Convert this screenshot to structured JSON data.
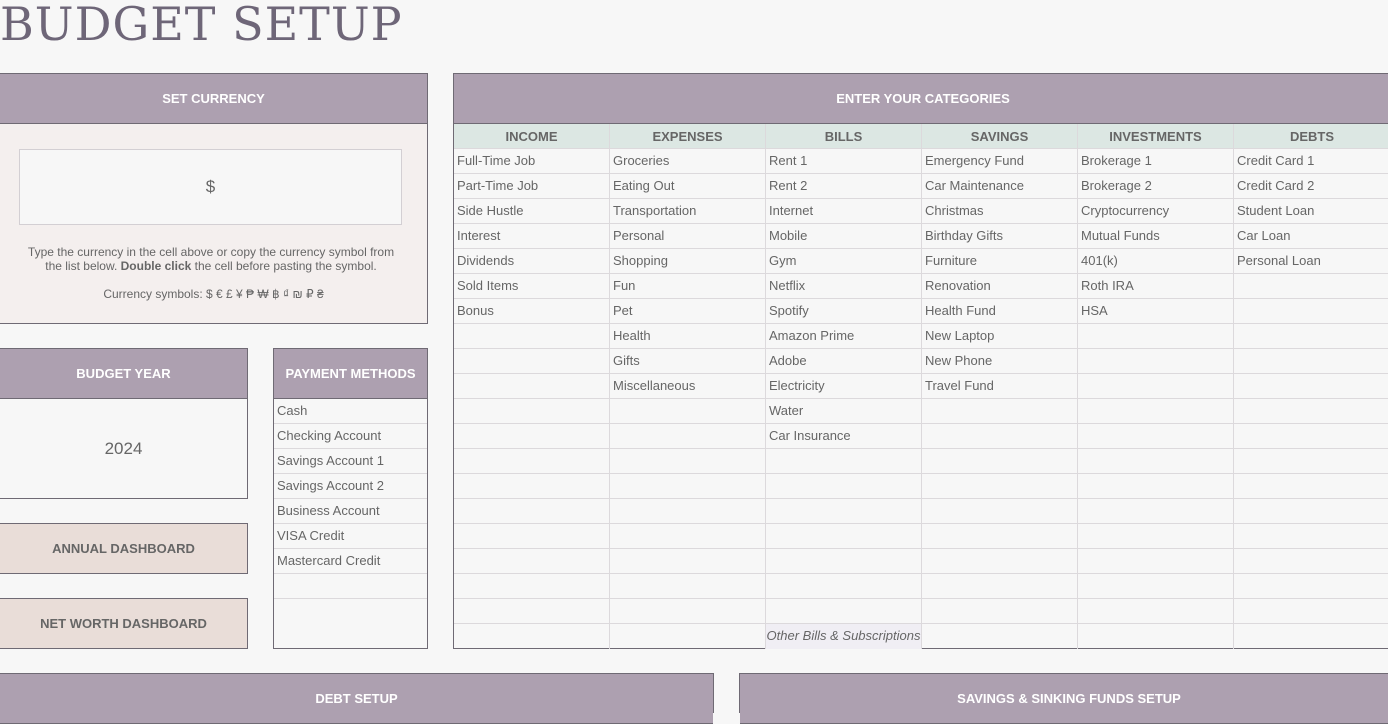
{
  "page_title": "BUDGET SETUP",
  "currency": {
    "header": "SET CURRENCY",
    "value": "$",
    "help_before": "Type the currency in the cell above or copy the currency symbol from the list below. ",
    "help_bold": "Double click",
    "help_after": " the cell before pasting the symbol.",
    "symbols_label": "Currency symbols: $ € £ ¥ ₱ ₩ ฿ ₫ ₪ ₽ ₴"
  },
  "budget_year": {
    "header": "BUDGET YEAR",
    "value": "2024"
  },
  "buttons": {
    "annual": "ANNUAL DASHBOARD",
    "net_worth": "NET WORTH DASHBOARD"
  },
  "payment_methods": {
    "header": "PAYMENT METHODS",
    "items": [
      "Cash",
      "Checking Account",
      "Savings Account 1",
      "Savings Account 2",
      "Business Account",
      "VISA Credit",
      "Mastercard Credit",
      "",
      ""
    ]
  },
  "categories": {
    "header": "ENTER YOUR CATEGORIES",
    "columns": [
      {
        "title": "INCOME",
        "items": [
          "Full-Time Job",
          "Part-Time Job",
          "Side Hustle",
          "Interest",
          "Dividends",
          "Sold Items",
          "Bonus",
          "",
          "",
          "",
          "",
          "",
          "",
          "",
          "",
          "",
          "",
          "",
          "",
          ""
        ]
      },
      {
        "title": "EXPENSES",
        "items": [
          "Groceries",
          "Eating Out",
          "Transportation",
          "Personal",
          "Shopping",
          "Fun",
          "Pet",
          "Health",
          "Gifts",
          "Miscellaneous",
          "",
          "",
          "",
          "",
          "",
          "",
          "",
          "",
          "",
          ""
        ]
      },
      {
        "title": "BILLS",
        "items": [
          "Rent 1",
          "Rent 2",
          "Internet",
          "Mobile",
          "Gym",
          "Netflix",
          "Spotify",
          "Amazon Prime",
          "Adobe",
          "Electricity",
          "Water",
          "Car Insurance",
          "",
          "",
          "",
          "",
          "",
          "",
          "",
          ""
        ],
        "note": "Other Bills & Subscriptions"
      },
      {
        "title": "SAVINGS",
        "items": [
          "Emergency Fund",
          "Car Maintenance",
          "Christmas",
          "Birthday Gifts",
          "Furniture",
          "Renovation",
          "Health Fund",
          "New Laptop",
          "New Phone",
          "Travel Fund",
          "",
          "",
          "",
          "",
          "",
          "",
          "",
          "",
          "",
          ""
        ]
      },
      {
        "title": "INVESTMENTS",
        "items": [
          "Brokerage 1",
          "Brokerage 2",
          "Cryptocurrency",
          "Mutual Funds",
          "401(k)",
          "Roth IRA",
          "HSA",
          "",
          "",
          "",
          "",
          "",
          "",
          "",
          "",
          "",
          "",
          "",
          "",
          ""
        ]
      },
      {
        "title": "DEBTS",
        "items": [
          "Credit Card 1",
          "Credit Card 2",
          "Student Loan",
          "Car Loan",
          "Personal Loan",
          "",
          "",
          "",
          "",
          "",
          "",
          "",
          "",
          "",
          "",
          "",
          "",
          "",
          "",
          ""
        ]
      }
    ]
  },
  "debt_setup": {
    "header": "DEBT SETUP"
  },
  "savings_setup": {
    "header": "SAVINGS & SINKING FUNDS SETUP"
  }
}
